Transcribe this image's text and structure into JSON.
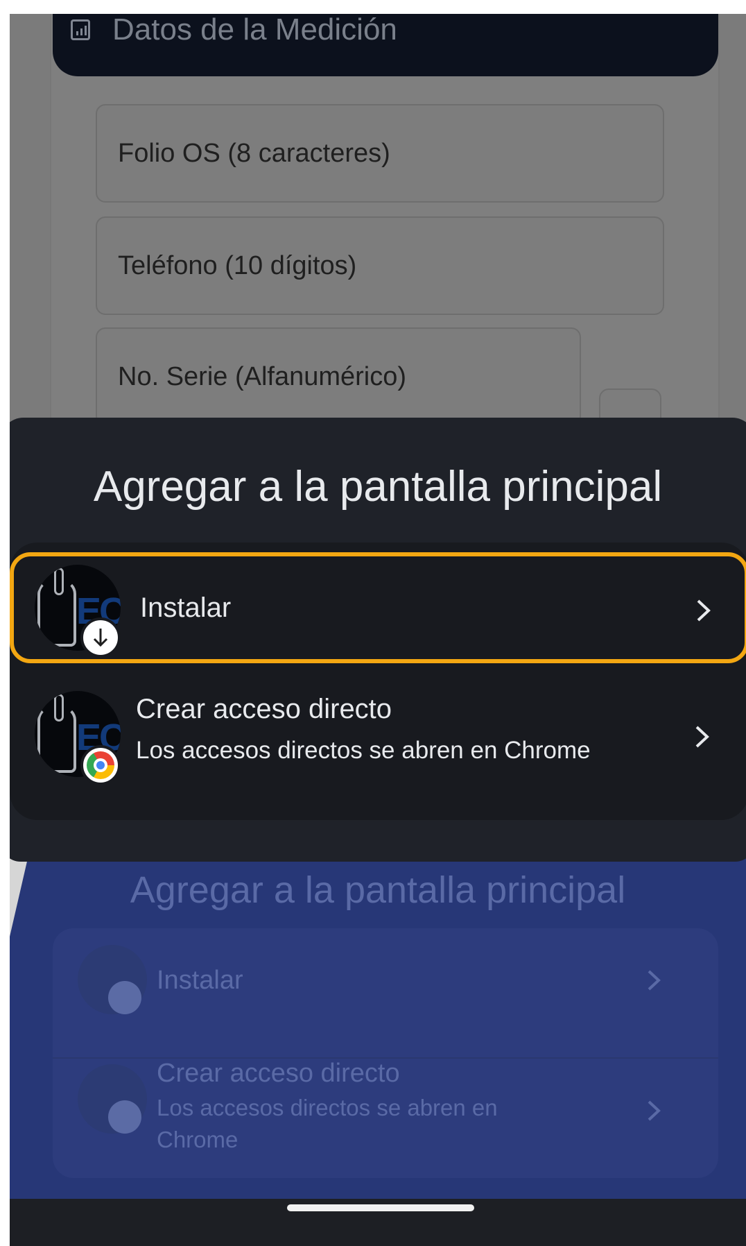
{
  "background_page": {
    "header_title": "Datos de la Medición",
    "header_icon": "chart-icon",
    "fields": [
      {
        "placeholder": "Folio OS (8 caracteres)"
      },
      {
        "placeholder": "Teléfono (10 dígitos)"
      },
      {
        "placeholder": "No. Serie (Alfanumérico)"
      }
    ],
    "qr_icon": "qr-scan-icon"
  },
  "sheet": {
    "title": "Agregar a la pantalla principal",
    "options": [
      {
        "label": "Instalar",
        "badge_icon": "download-icon",
        "chevron_icon": "chevron-right-icon"
      },
      {
        "label": "Crear acceso directo",
        "subtitle": "Los accesos directos se abren en Chrome",
        "badge_icon": "chrome-icon",
        "chevron_icon": "chevron-right-icon"
      }
    ],
    "app_logo_text": "ECD",
    "highlight_color": "#f3a712"
  },
  "ghost_sheet": {
    "title": "Agregar a la pantalla principal",
    "options": [
      {
        "label": "Instalar"
      },
      {
        "label": "Crear acceso directo",
        "subtitle": "Los accesos directos se abren en Chrome"
      }
    ]
  },
  "colors": {
    "sheet_bg": "#1f2229",
    "option_bg": "#181a1f",
    "ghost_bg": "#273777",
    "header_bg": "#0c111d"
  }
}
